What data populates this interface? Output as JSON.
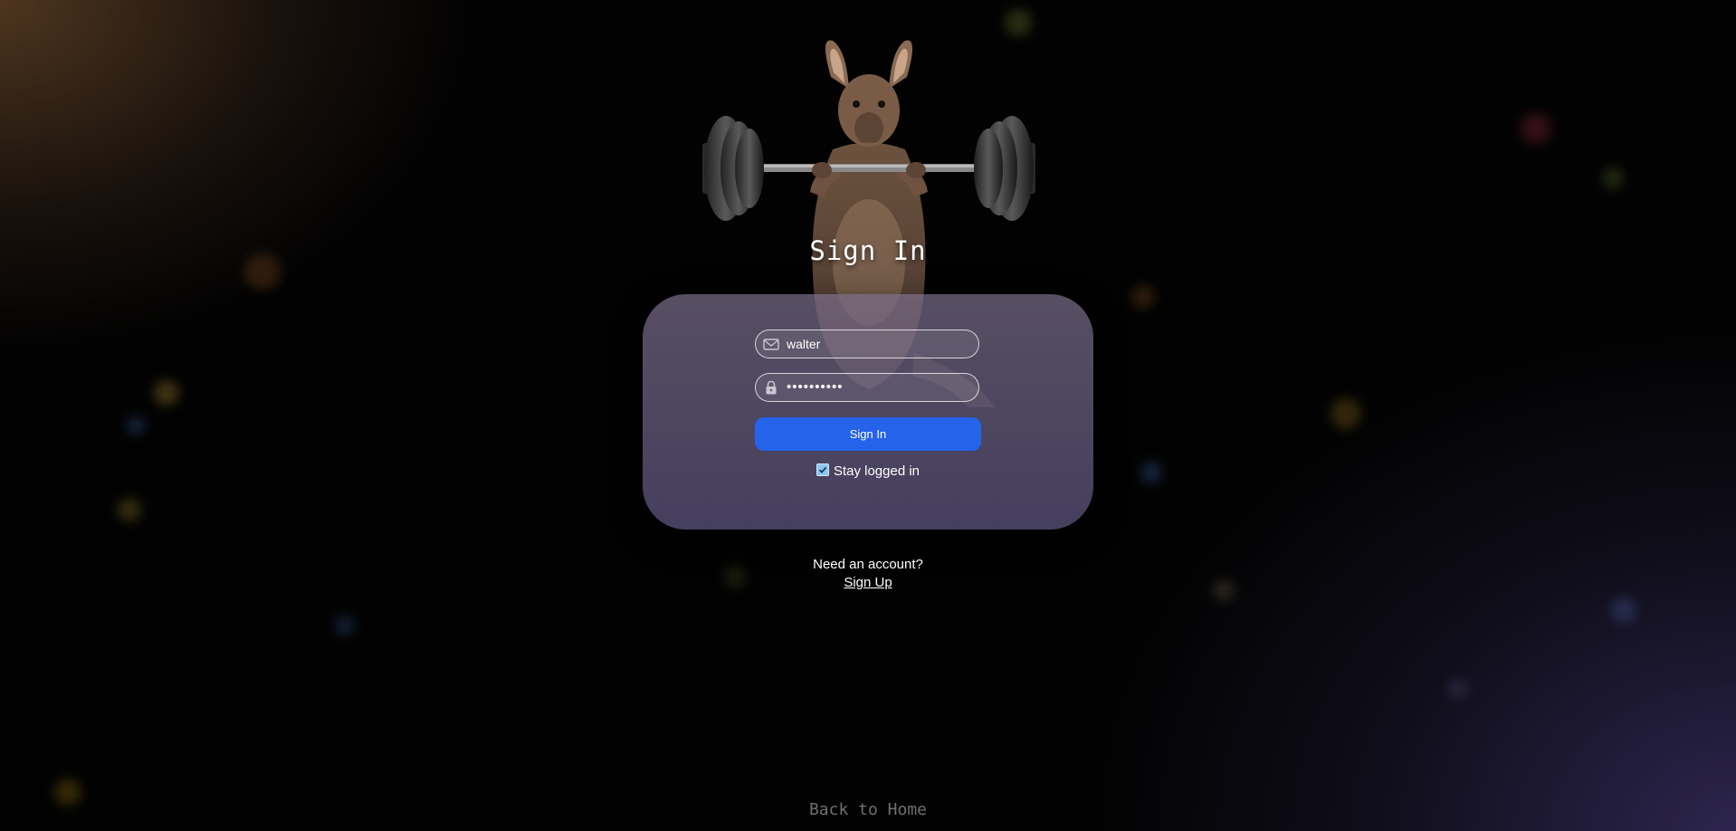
{
  "header": {
    "title": "Sign In"
  },
  "form": {
    "username_value": "walter",
    "password_value": "••••••••••",
    "submit_label": "Sign In",
    "stay_logged_in_label": "Stay logged in",
    "stay_logged_in_checked": true
  },
  "footer": {
    "need_account_text": "Need an account?",
    "signup_label": "Sign Up",
    "back_home_label": "Back to Home"
  },
  "icons": {
    "username": "envelope-icon",
    "password": "lock-icon",
    "hero": "kangaroo-barbell-illustration"
  },
  "colors": {
    "accent": "#2563eb",
    "checkbox": "#8cc6f5"
  }
}
